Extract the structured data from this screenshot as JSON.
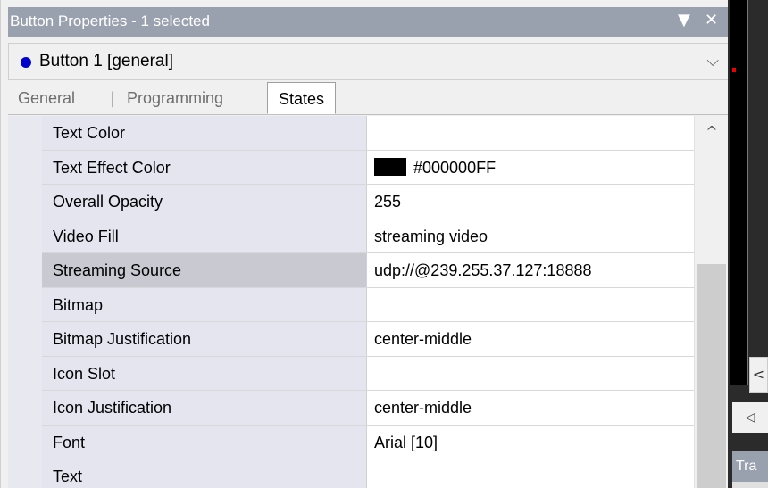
{
  "panel": {
    "title": "Button Properties - 1 selected",
    "dropdown_icon": "▼",
    "close_icon": "✕"
  },
  "selector": {
    "label": "Button 1  [general]",
    "dot_color": "#0000cc",
    "chevron": "⌵"
  },
  "tabs": {
    "general": "General",
    "programming": "Programming",
    "states": "States",
    "active": "States"
  },
  "properties": [
    {
      "name": "Text Color",
      "value": ""
    },
    {
      "name": "Text Effect Color",
      "value": "#000000FF",
      "swatch": "#000000"
    },
    {
      "name": "Overall Opacity",
      "value": "255"
    },
    {
      "name": "Video Fill",
      "value": "streaming video"
    },
    {
      "name": "Streaming Source",
      "value": "udp://@239.255.37.127:18888"
    },
    {
      "name": "Bitmap",
      "value": ""
    },
    {
      "name": "Bitmap Justification",
      "value": "center-middle"
    },
    {
      "name": "Icon Slot",
      "value": ""
    },
    {
      "name": "Icon Justification",
      "value": "center-middle"
    },
    {
      "name": "Font",
      "value": "Arial [10]"
    },
    {
      "name": "Text",
      "value": ""
    }
  ],
  "selected_property": "Streaming Source",
  "scrollbar": {
    "up_arrow": "^"
  },
  "side_panel": {
    "collapse_left": "<",
    "arrow_left": "◁",
    "tab_label": "Tra"
  }
}
